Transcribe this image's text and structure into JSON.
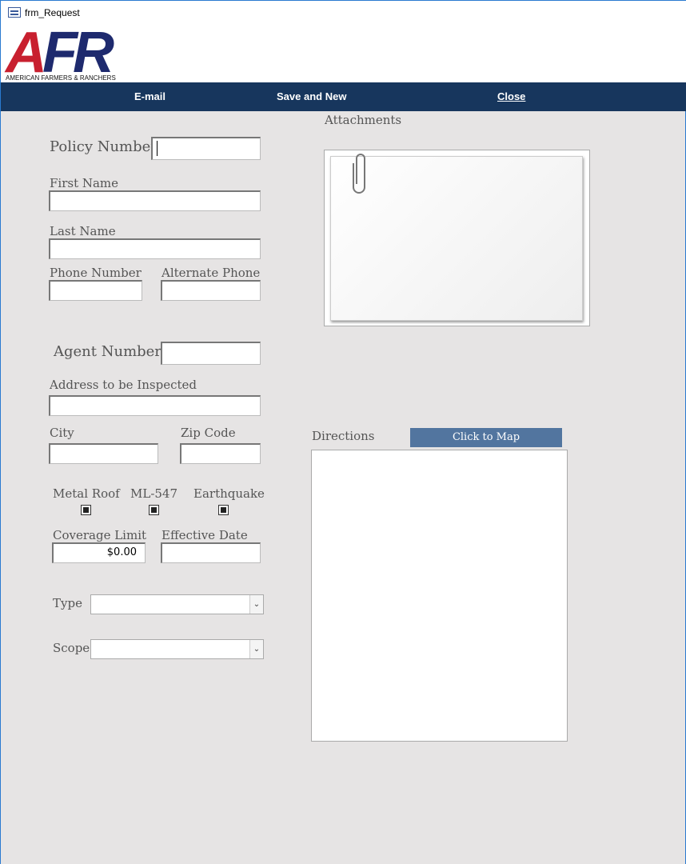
{
  "window": {
    "title": "frm_Request"
  },
  "logo": {
    "letters": "AFR",
    "tagline": "AMERICAN FARMERS & RANCHERS",
    "colors": {
      "red": "#c8202f",
      "navy": "#1e2a6e"
    }
  },
  "toolbar": {
    "email": "E-mail",
    "save_new": "Save and New",
    "close": "Close",
    "bg": "#17365d"
  },
  "form": {
    "policy_number": {
      "label": "Policy Number",
      "value": ""
    },
    "first_name": {
      "label": "First Name",
      "value": ""
    },
    "last_name": {
      "label": "Last Name",
      "value": ""
    },
    "phone": {
      "label": "Phone Number",
      "value": ""
    },
    "alt_phone": {
      "label": "Alternate Phone",
      "value": ""
    },
    "agent_number": {
      "label": "Agent Number",
      "value": ""
    },
    "address": {
      "label": "Address to be Inspected",
      "value": ""
    },
    "city": {
      "label": "City",
      "value": ""
    },
    "zip": {
      "label": "Zip Code",
      "value": ""
    },
    "metal_roof": {
      "label": "Metal Roof",
      "state": "null"
    },
    "ml547": {
      "label": "ML-547",
      "state": "null"
    },
    "earthquake": {
      "label": "Earthquake",
      "state": "null"
    },
    "coverage_limit": {
      "label": "Coverage Limit",
      "value": "$0.00"
    },
    "effective_date": {
      "label": "Effective Date",
      "value": ""
    },
    "type": {
      "label": "Type",
      "value": ""
    },
    "scope": {
      "label": "Scope",
      "value": ""
    },
    "attachments": {
      "label": "Attachments"
    },
    "directions": {
      "label": "Directions",
      "value": ""
    },
    "map_button": "Click to Map"
  }
}
